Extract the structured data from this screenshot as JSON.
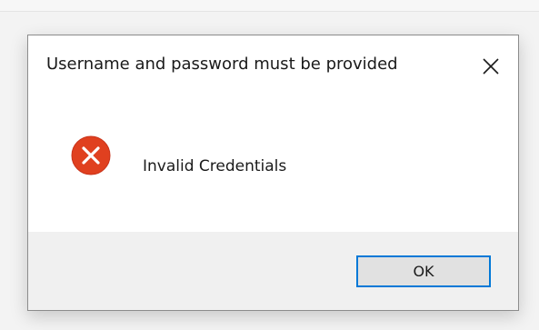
{
  "dialog": {
    "title": "Username and password must be provided",
    "close_icon": "close-icon",
    "message": "Invalid Credentials",
    "icon": "error-icon",
    "ok_label": "OK"
  },
  "colors": {
    "error_red": "#e0401f",
    "focus_blue": "#0078d7",
    "footer_gray": "#f0f0f0"
  }
}
